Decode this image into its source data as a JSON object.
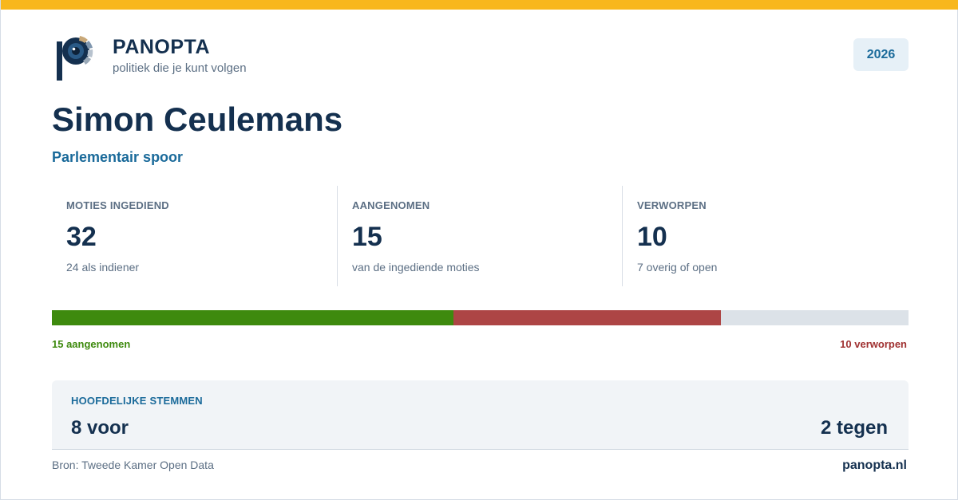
{
  "brand": {
    "name": "PANOPTA",
    "tagline": "politiek die je kunt volgen",
    "accent": "#f8b71c",
    "primary": "#14304f",
    "link": "#1a6a9a"
  },
  "year_badge": "2026",
  "person": {
    "name": "Simon Ceulemans",
    "track": "Parlementair spoor"
  },
  "stats": [
    {
      "label": "MOTIES INGEDIEND",
      "value": "32",
      "sub": "24 als indiener"
    },
    {
      "label": "AANGENOMEN",
      "value": "15",
      "sub": "van de ingediende moties"
    },
    {
      "label": "VERWORPEN",
      "value": "10",
      "sub": "7 overig of open"
    }
  ],
  "progress": {
    "total": 32,
    "segments": [
      {
        "count": 15,
        "color": "#3e8a0e"
      },
      {
        "count": 10,
        "color": "#ad4545"
      }
    ],
    "rest_color": "#dce2e8",
    "label_left": "15 aangenomen",
    "label_right": "10 verworpen"
  },
  "votes": {
    "title": "HOOFDELIJKE STEMMEN",
    "for": "8 voor",
    "against": "2 tegen"
  },
  "footer": {
    "source": "Bron: Tweede Kamer Open Data",
    "site": "panopta.nl"
  }
}
